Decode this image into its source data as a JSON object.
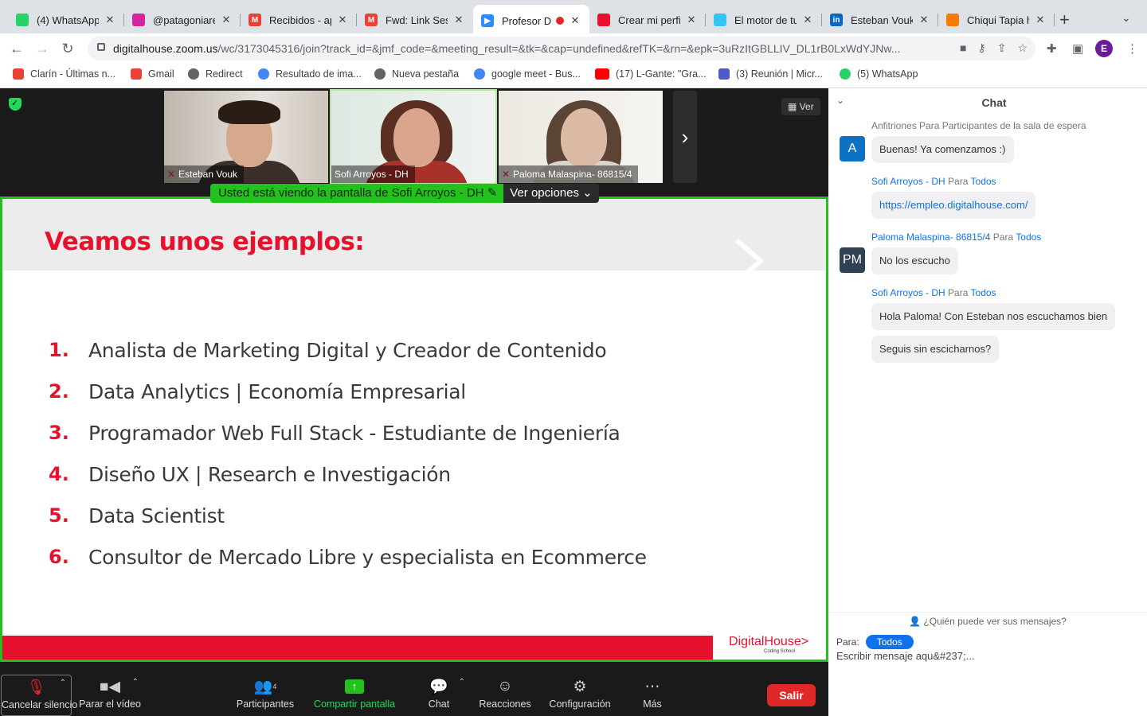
{
  "browser": {
    "tabs": [
      {
        "title": "(4) WhatsApp",
        "color": "#25d366"
      },
      {
        "title": "@patagoniare",
        "color": "#d6249f"
      },
      {
        "title": "Recibidos - ap",
        "color": "#ea4335"
      },
      {
        "title": "Fwd: Link Sesi",
        "color": "#ea4335"
      },
      {
        "title": "Profesor D",
        "color": "#2d8cff"
      },
      {
        "title": "Crear mi perfi",
        "color": "#e8112d"
      },
      {
        "title": "El motor de tu",
        "color": "#36c5f0"
      },
      {
        "title": "Esteban Vouk",
        "color": "#0a66c2"
      },
      {
        "title": "Chiqui Tapia h",
        "color": "#f57c00"
      }
    ],
    "url_host": "digitalhouse.zoom.us",
    "url_path": "/wc/3173045316/join?track_id=&jmf_code=&meeting_result=&tk=&cap=undefined&refTK=&rn=&epk=3uRzItGBLLIV_DL1rB0LxWdYJNw...",
    "profile_initial": "E",
    "bookmarks": [
      {
        "label": "Clarín - Últimas n...",
        "color": "#ea4335"
      },
      {
        "label": "Gmail",
        "color": "#ea4335"
      },
      {
        "label": "Redirect",
        "color": "#5f6368"
      },
      {
        "label": "Resultado de ima...",
        "color": "#4285f4"
      },
      {
        "label": "Nueva pestaña",
        "color": "#5f6368"
      },
      {
        "label": "google meet - Bus...",
        "color": "#4285f4"
      },
      {
        "label": "(17) L-Gante: \"Gra...",
        "color": "#ff0000"
      },
      {
        "label": "(3) Reunión | Micr...",
        "color": "#5059c9"
      },
      {
        "label": "(5) WhatsApp",
        "color": "#25d366"
      }
    ]
  },
  "meeting": {
    "participants": [
      {
        "name": "Esteban Vouk",
        "muted": true
      },
      {
        "name": "Sofi Arroyos - DH",
        "muted": false
      },
      {
        "name": "Paloma Malaspina- 86815/4",
        "muted": true
      }
    ],
    "view_label": "Ver",
    "share_banner": "Usted está viendo la pantalla de Sofi Arroyos - DH",
    "view_options": "Ver opciones"
  },
  "slide": {
    "title": "Veamos unos ejemplos:",
    "items": [
      {
        "num": "1.",
        "text": "Analista de Marketing Digital y Creador de Contenido"
      },
      {
        "num": "2.",
        "text": "Data Analytics | Economía Empresarial"
      },
      {
        "num": "3.",
        "text": "Programador Web Full Stack - Estudiante de Ingeniería"
      },
      {
        "num": "4.",
        "text": "Diseño UX | Research e Investigación"
      },
      {
        "num": "5.",
        "text": "Data Scientist"
      },
      {
        "num": "6.",
        "text": "Consultor de Mercado Libre y especialista en Ecommerce"
      }
    ],
    "logo": "DigitalHouse>",
    "logo_sub": "Coding School"
  },
  "controls": {
    "unmute": "Cancelar silencio",
    "stop_video": "Parar el vídeo",
    "participants": "Participantes",
    "participants_count": "4",
    "share": "Compartir pantalla",
    "chat": "Chat",
    "reactions": "Reacciones",
    "settings": "Configuración",
    "more": "Más",
    "leave": "Salir"
  },
  "chat": {
    "title": "Chat",
    "messages": [
      {
        "from": "Anfitriones",
        "to_word": "Para",
        "to": "Participantes de la sala de espera",
        "avatar": "A",
        "avatar_color": "#0e72c4",
        "texts": [
          "Buenas! Ya comenzamos :)"
        ]
      },
      {
        "from": "Sofi Arroyos - DH",
        "to_word": "Para",
        "to": "Todos",
        "texts": [
          "https://empleo.digitalhouse.com/"
        ]
      },
      {
        "from": "Paloma Malaspina- 86815/4",
        "to_word": "Para",
        "to": "Todos",
        "avatar": "PM",
        "avatar_color": "#2f4154",
        "texts": [
          "No los escucho"
        ]
      },
      {
        "from": "Sofi Arroyos - DH",
        "to_word": "Para",
        "to": "Todos",
        "texts": [
          "Hola Paloma! Con Esteban nos escuchamos bien",
          "Seguis sin escicharnos?"
        ]
      }
    ],
    "who_sees": "¿Quién puede ver sus mensajes?",
    "to_label": "Para:",
    "to_value": "Todos",
    "input_placeholder": "Escribir mensaje aqu&#237;..."
  }
}
